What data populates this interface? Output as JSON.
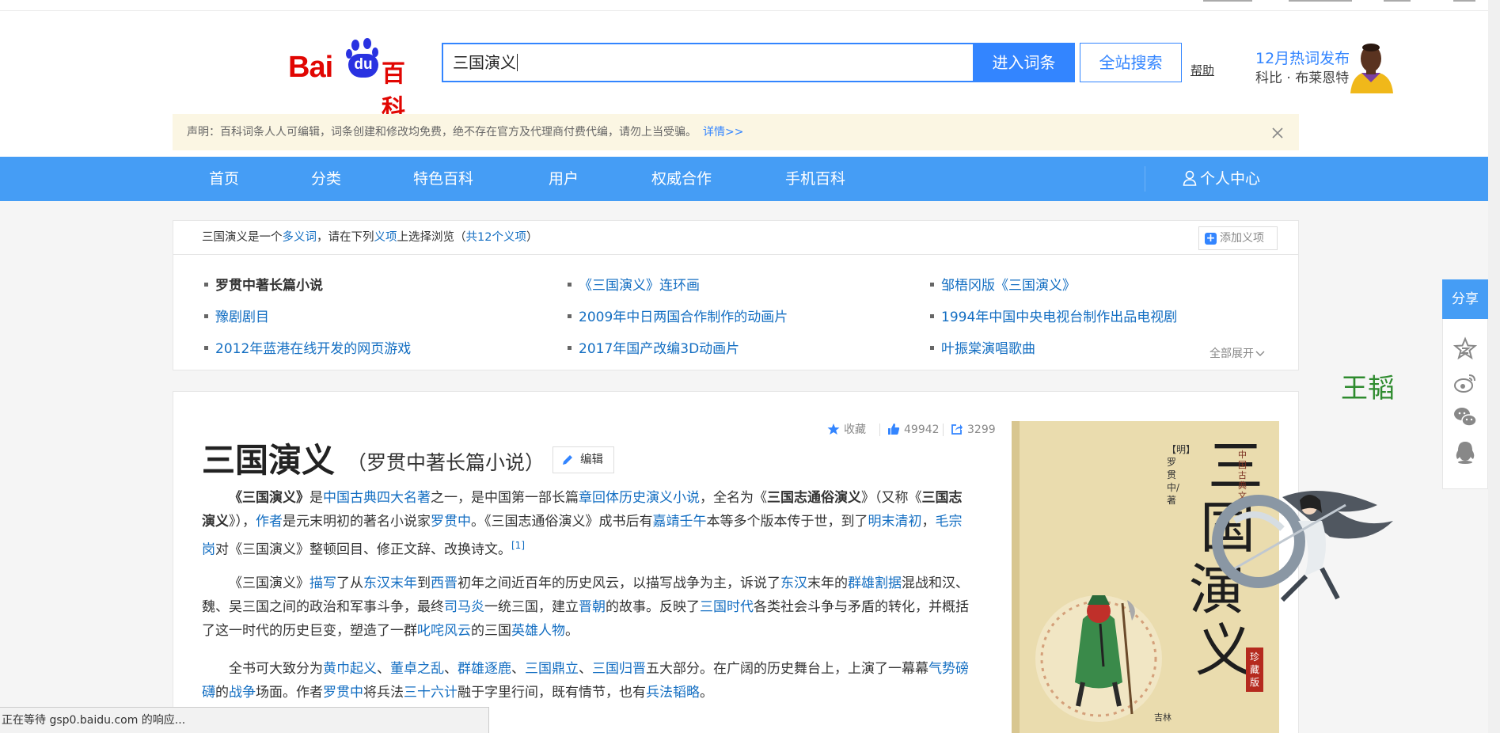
{
  "header": {
    "logo_alt": "Bai du 百科",
    "logo_bai": "Bai",
    "logo_du": "du",
    "logo_baike": "百科",
    "search_value": "三国演义",
    "enter_button": "进入词条",
    "site_search_button": "全站搜索",
    "help_link": "帮助",
    "hot_title": "12月热词发布",
    "hot_name": "科比 · 布莱恩特"
  },
  "notice": {
    "text": "声明：百科词条人人可编辑，词条创建和修改均免费，绝不存在官方及代理商付费代编，请勿上当受骗。",
    "more": "详情>>"
  },
  "nav": {
    "items": [
      "首页",
      "分类",
      "特色百科",
      "用户",
      "权威合作",
      "手机百科"
    ],
    "user_center": "个人中心"
  },
  "polysemy": {
    "head": {
      "term": "三国演义",
      "t1": "是一个",
      "link1": "多义词",
      "t2": "，请在下列",
      "link2": "义项",
      "t3": "上选择浏览（",
      "link3": "共12个义项",
      "t4": "）"
    },
    "add_button": "添加义项",
    "items": [
      "罗贯中著长篇小说",
      "《三国演义》连环画",
      "邹梧冈版《三国演义》",
      "豫剧剧目",
      "2009年中日两国合作制作的动画片",
      "1994年中国中央电视台制作出品电视剧",
      "2012年蓝港在线开发的网页游戏",
      "2017年国产改编3D动画片",
      "叶振棠演唱歌曲"
    ],
    "expand": "全部展开"
  },
  "entry": {
    "title": "三国演义",
    "subtitle": "（罗贯中著长篇小说）",
    "edit_button": "编辑",
    "collect_label": "收藏",
    "likes": "49942",
    "shares": "3299",
    "paragraphs": {
      "p1": [
        {
          "t": "《三国演义》",
          "b": true
        },
        {
          "t": "是"
        },
        {
          "t": "中国古典四大名著",
          "l": true
        },
        {
          "t": "之一，是中国第一部长篇"
        },
        {
          "t": "章回体",
          "l": true
        },
        {
          "t": "历史演义小说",
          "l": true
        },
        {
          "t": "，全名为《"
        },
        {
          "t": "三国志通俗演义",
          "b": true
        },
        {
          "t": "》（又称《"
        },
        {
          "t": "三国志演义",
          "b": true
        },
        {
          "t": "》），"
        },
        {
          "t": "作者",
          "l": true
        },
        {
          "t": "是元末明初的著名小说家"
        },
        {
          "t": "罗贯中",
          "l": true
        },
        {
          "t": "。《三国志通俗演义》成书后有"
        },
        {
          "t": "嘉靖壬午",
          "l": true
        },
        {
          "t": "本等多个版本传于世，到了"
        },
        {
          "t": "明末清初",
          "l": true
        },
        {
          "t": "，"
        },
        {
          "t": "毛宗岗",
          "l": true
        },
        {
          "t": "对《三国演义》整顿回目、修正文辞、改换诗文。"
        },
        {
          "t": "[1]",
          "s": true
        }
      ],
      "p2": [
        {
          "t": "《三国演义》"
        },
        {
          "t": "描写",
          "l": true
        },
        {
          "t": "了从"
        },
        {
          "t": "东汉末年",
          "l": true
        },
        {
          "t": "到"
        },
        {
          "t": "西晋",
          "l": true
        },
        {
          "t": "初年之间近百年的历史风云，以描写战争为主，诉说了"
        },
        {
          "t": "东汉",
          "l": true
        },
        {
          "t": "末年的"
        },
        {
          "t": "群雄割据",
          "l": true
        },
        {
          "t": "混战和汉、魏、吴三国之间的政治和军事斗争，最终"
        },
        {
          "t": "司马炎",
          "l": true
        },
        {
          "t": "一统三国，建立"
        },
        {
          "t": "晋朝",
          "l": true
        },
        {
          "t": "的故事。反映了"
        },
        {
          "t": "三国时代",
          "l": true
        },
        {
          "t": "各类社会斗争与矛盾的转化，并概括了这一时代的历史巨变，塑造了一群"
        },
        {
          "t": "叱咤风云",
          "l": true
        },
        {
          "t": "的三国"
        },
        {
          "t": "英雄人物",
          "l": true
        },
        {
          "t": "。"
        }
      ],
      "p3": [
        {
          "t": "全书可大致分为"
        },
        {
          "t": "黄巾起义",
          "l": true
        },
        {
          "t": "、"
        },
        {
          "t": "董卓之乱",
          "l": true
        },
        {
          "t": "、"
        },
        {
          "t": "群雄逐鹿",
          "l": true
        },
        {
          "t": "、"
        },
        {
          "t": "三国鼎立",
          "l": true
        },
        {
          "t": "、"
        },
        {
          "t": "三国归晋",
          "l": true
        },
        {
          "t": "五大部分。在广阔的历史舞台上，上演了一幕幕"
        },
        {
          "t": "气势磅礴",
          "l": true
        },
        {
          "t": "的"
        },
        {
          "t": "战争",
          "l": true
        },
        {
          "t": "场面。作者"
        },
        {
          "t": "罗贯中",
          "l": true
        },
        {
          "t": "将兵法"
        },
        {
          "t": "三十六计",
          "l": true
        },
        {
          "t": "融于字里行间，既有情节，也有"
        },
        {
          "t": "兵法韬略",
          "l": true
        },
        {
          "t": "。"
        }
      ]
    }
  },
  "cover": {
    "title_chars": [
      "三",
      "国",
      "演",
      "义"
    ],
    "series": "中国古典文",
    "author": "【明】罗贯中/著",
    "seal": "珍藏版",
    "publisher": "吉林"
  },
  "share": {
    "label": "分享",
    "icons": [
      "star-icon",
      "weibo-icon",
      "wechat-icon",
      "qq-icon"
    ]
  },
  "floating": {
    "name": "王韬"
  },
  "status_bar": {
    "text": "正在等待 gsp0.baidu.com 的响应..."
  },
  "colors": {
    "accent": "#3385ff",
    "nav_bg": "#459df5",
    "brand_red": "#e10602",
    "link": "#136ec2",
    "notice_bg": "#fbf6e3"
  }
}
